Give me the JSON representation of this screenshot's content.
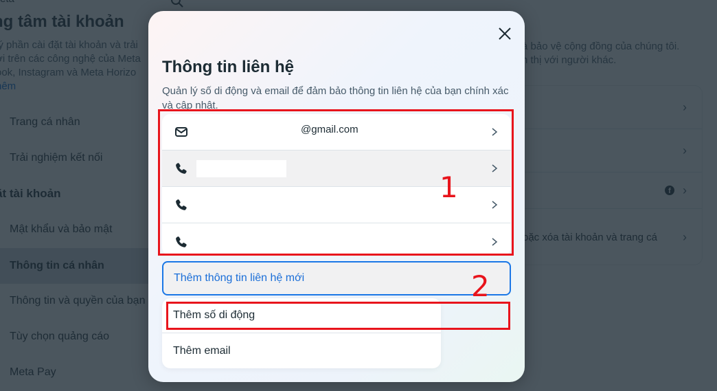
{
  "background": {
    "top_label": "eta",
    "title": "ng tâm tài khoản",
    "description_lines": [
      "lý phần cài đặt tài khoản và trải",
      "ời trên các công nghệ của Meta",
      "ook, Instagram và Meta Horizo"
    ],
    "see_more": "hêm",
    "sidebar": {
      "items_top": [
        {
          "label": "Trang cá nhân"
        },
        {
          "label": "Trải nghiệm kết nối"
        }
      ],
      "section_heading": "ặt tài khoản",
      "items_bottom": [
        {
          "label": "Mật khẩu và bảo mật",
          "active": false
        },
        {
          "label": "Thông tin cá nhân",
          "active": true
        },
        {
          "label": "Thông tin và quyền của bạn",
          "active": false
        },
        {
          "label": "Tùy chọn quảng cáo",
          "active": false
        },
        {
          "label": "Meta Pay",
          "active": false
        }
      ]
    },
    "right_text_lines": [
      "à bảo vệ cộng đồng của chúng tôi.",
      "n thị với người khác."
    ],
    "right_rows": [
      {
        "text": ""
      },
      {
        "text": ""
      },
      {
        "text": "",
        "icon": "facebook-icon"
      },
      {
        "text": "oặc xóa tài khoản và trang cá"
      }
    ],
    "chevron": "›"
  },
  "modal": {
    "title": "Thông tin liên hệ",
    "description": "Quản lý số di động và email để đảm bảo thông tin liên hệ của bạn chính xác và cập nhật.",
    "contacts": [
      {
        "type": "email",
        "icon": "mail-icon",
        "value": "@gmail.com",
        "redacted": false
      },
      {
        "type": "phone",
        "icon": "phone-icon",
        "value": "",
        "redacted": true
      },
      {
        "type": "phone",
        "icon": "phone-icon",
        "value": "",
        "redacted": false
      },
      {
        "type": "phone",
        "icon": "phone-icon",
        "value": "",
        "redacted": false
      }
    ],
    "add_button": "Thêm thông tin liên hệ mới",
    "dropdown_options": [
      {
        "label": "Thêm số di động"
      },
      {
        "label": "Thêm email"
      }
    ]
  },
  "annotations": [
    {
      "number": "1",
      "color": "#e8141c"
    },
    {
      "number": "2",
      "color": "#e8141c"
    }
  ],
  "colors": {
    "accent_blue": "#1a77e6",
    "annotation_red": "#e8141c",
    "text_primary": "#1c2b33"
  }
}
